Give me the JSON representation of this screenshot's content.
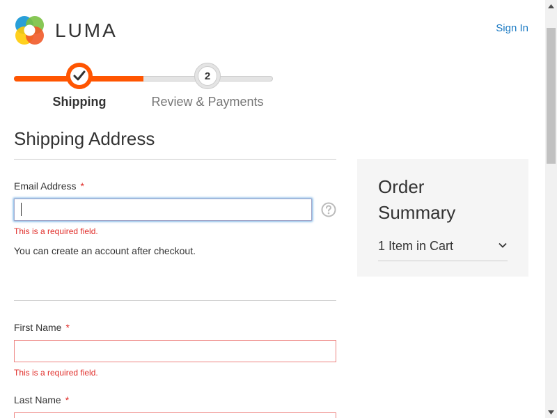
{
  "header": {
    "logo_text": "LUMA",
    "signin_label": "Sign In"
  },
  "progress": {
    "steps": [
      {
        "number": "1",
        "label": "Shipping",
        "state": "active-complete"
      },
      {
        "number": "2",
        "label": "Review & Payments",
        "state": "pending"
      }
    ],
    "completed_fraction": 0.5
  },
  "shipping": {
    "title": "Shipping Address",
    "email": {
      "label": "Email Address",
      "required_marker": "*",
      "value": "",
      "error": "This is a required field."
    },
    "account_note": "You can create an account after checkout.",
    "first_name": {
      "label": "First Name",
      "required_marker": "*",
      "value": "",
      "error": "This is a required field."
    },
    "last_name": {
      "label": "Last Name",
      "required_marker": "*",
      "value": ""
    }
  },
  "summary": {
    "title": "Order Summary",
    "items_toggle": "1 Item in Cart"
  },
  "colors": {
    "accent": "#ff5501",
    "link": "#1979c3",
    "error": "#e02b27",
    "summary_bg": "#f5f5f5"
  },
  "icons": {
    "logo": "luma-logo-icon",
    "check": "checkmark-icon",
    "help": "question-circle-icon",
    "chevron": "chevron-down-icon"
  }
}
